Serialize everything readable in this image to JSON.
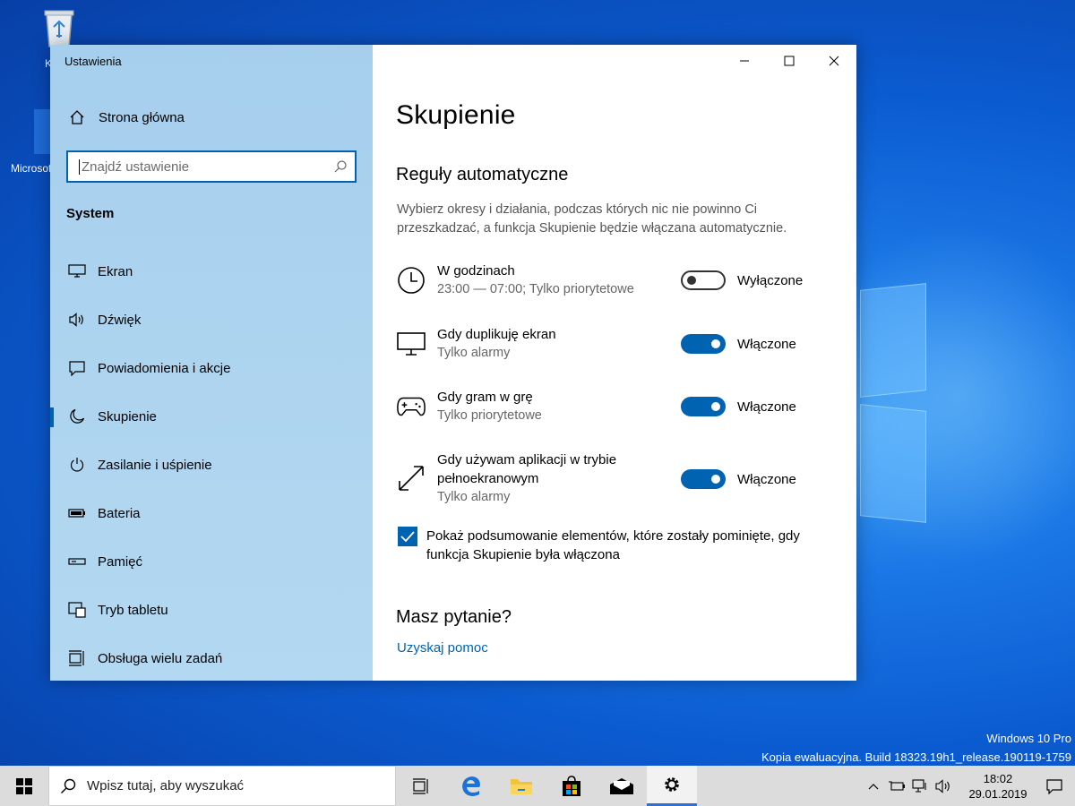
{
  "desktop": {
    "icons": [
      {
        "name": "recycle-bin",
        "label": "K"
      },
      {
        "name": "edge",
        "label": "Microsoft Edge"
      }
    ],
    "watermark": {
      "line1": "Windows 10 Pro",
      "line2": "Kopia ewaluacyjna. Build 18323.19h1_release.190119-1759"
    }
  },
  "window": {
    "app_title": "Ustawienia",
    "sidebar": {
      "home_label": "Strona główna",
      "search_placeholder": "Znajdź ustawienie",
      "section_title": "System",
      "items": [
        {
          "label": "Ekran",
          "icon": "monitor-icon"
        },
        {
          "label": "Dźwięk",
          "icon": "speaker-icon"
        },
        {
          "label": "Powiadomienia i akcje",
          "icon": "notification-icon"
        },
        {
          "label": "Skupienie",
          "icon": "moon-icon",
          "active": true
        },
        {
          "label": "Zasilanie i uśpienie",
          "icon": "power-icon"
        },
        {
          "label": "Bateria",
          "icon": "battery-icon"
        },
        {
          "label": "Pamięć",
          "icon": "storage-icon"
        },
        {
          "label": "Tryb tabletu",
          "icon": "tablet-icon"
        },
        {
          "label": "Obsługa wielu zadań",
          "icon": "multitask-icon"
        }
      ]
    },
    "content": {
      "title": "Skupienie",
      "subtitle": "Reguły automatyczne",
      "description": "Wybierz okresy i działania, podczas których nic nie powinno Ci przeszkadzać, a funkcja Skupienie będzie włączana automatycznie.",
      "rules": [
        {
          "name": "W godzinach",
          "detail": "23:00 — 07:00; Tylko priorytetowe",
          "state": false,
          "state_label": "Wyłączone",
          "icon": "clock-icon"
        },
        {
          "name": "Gdy duplikuję ekran",
          "detail": "Tylko alarmy",
          "state": true,
          "state_label": "Włączone",
          "icon": "display-icon"
        },
        {
          "name": "Gdy gram w grę",
          "detail": "Tylko priorytetowe",
          "state": true,
          "state_label": "Włączone",
          "icon": "gamepad-icon"
        },
        {
          "name": "Gdy używam aplikacji w trybie pełnoekranowym",
          "detail": "Tylko alarmy",
          "state": true,
          "state_label": "Włączone",
          "icon": "fullscreen-icon"
        }
      ],
      "summary_checkbox": {
        "checked": true,
        "label": "Pokaż podsumowanie elementów, które zostały pominięte, gdy funkcja Skupienie była włączona"
      },
      "help_title": "Masz pytanie?",
      "help_link": "Uzyskaj pomoc"
    }
  },
  "taskbar": {
    "search_placeholder": "Wpisz tutaj, aby wyszukać",
    "time": "18:02",
    "date": "29.01.2019"
  },
  "colors": {
    "accent": "#0063b1",
    "sidebar_bg": "#acd3ef",
    "taskbar_bg": "#dcdcdc"
  }
}
